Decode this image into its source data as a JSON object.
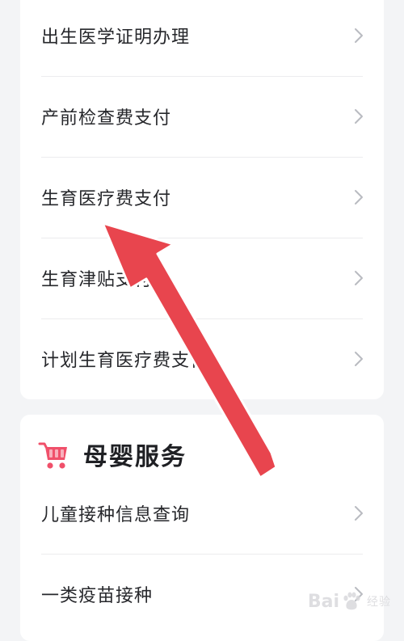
{
  "top_card": {
    "items": [
      {
        "label": "出生医学证明办理",
        "icon": "chevron-right-icon"
      },
      {
        "label": "产前检查费支付",
        "icon": "chevron-right-icon"
      },
      {
        "label": "生育医疗费支付",
        "icon": "chevron-right-icon"
      },
      {
        "label": "生育津贴支付",
        "icon": "chevron-right-icon"
      },
      {
        "label": "计划生育医疗费支付",
        "icon": "chevron-right-icon"
      }
    ]
  },
  "maternal_section": {
    "title": "母婴服务",
    "icon": "stroller-icon",
    "items": [
      {
        "label": "儿童接种信息查询",
        "icon": "chevron-right-icon"
      },
      {
        "label": "一类疫苗接种",
        "icon": "chevron-right-icon"
      }
    ]
  },
  "watermark": {
    "brand": "Bai",
    "suffix": "经验"
  },
  "colors": {
    "arrow": "#e8454e",
    "section_icon": "#f0506a",
    "chevron": "#b9bbc1"
  }
}
